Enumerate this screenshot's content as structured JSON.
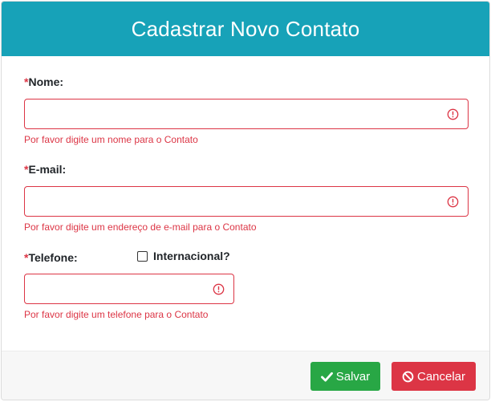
{
  "modal": {
    "title": "Cadastrar Novo Contato"
  },
  "form": {
    "required_marker": "*",
    "nome": {
      "label": "Nome:",
      "value": "",
      "error": "Por favor digite um nome para o Contato",
      "icon": "exclamation-circle-icon"
    },
    "email": {
      "label": "E-mail:",
      "value": "",
      "error": "Por favor digite um endereço de e-mail para o Contato",
      "icon": "exclamation-circle-icon"
    },
    "telefone": {
      "label": "Telefone:",
      "value": "",
      "error": "Por favor digite um telefone para o Contato",
      "icon": "exclamation-circle-icon"
    },
    "internacional": {
      "label": "Internacional?",
      "checked": false
    }
  },
  "footer": {
    "save_label": "Salvar",
    "save_icon": "check-icon",
    "cancel_label": "Cancelar",
    "cancel_icon": "ban-icon"
  },
  "colors": {
    "header": "#17a2b8",
    "danger": "#dc3545",
    "success": "#28a745",
    "footer_bg": "#f7f7f7"
  }
}
